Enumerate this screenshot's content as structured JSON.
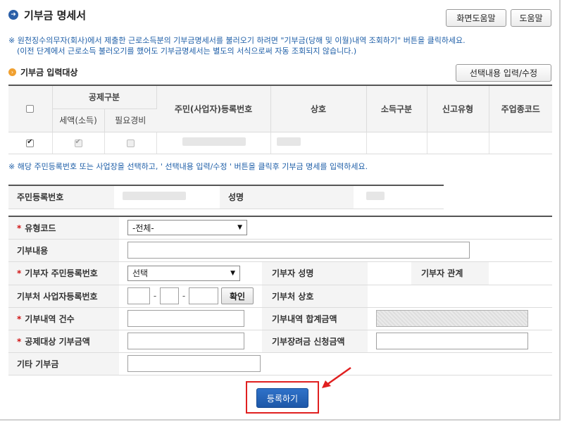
{
  "header": {
    "title": "기부금 명세서",
    "screen_help_label": "화면도움말",
    "help_label": "도움말"
  },
  "notice": {
    "line1": "※ 원천징수의무자(회사)에서 제출한 근로소득분의 기부금명세서를 불러오기 하려면 \"기부금(당해 및 이월)내역 조회하기\" 버튼을 클릭하세요.",
    "line2": "(이전 단계에서 근로소득 불러오기를 했어도 기부금명세서는 별도의 서식으로써 자동 조회되지 않습니다.)"
  },
  "target_section": {
    "title": "기부금 입력대상",
    "edit_button_label": "선택내용 입력/수정",
    "columns": {
      "deduction_group": "공제구분",
      "tax_credit": "세액(소득)",
      "necessary_expense": "필요경비",
      "reg_no": "주민(사업자)등록번호",
      "company": "상호",
      "income_type": "소득구분",
      "report_type": "신고유형",
      "business_code": "주업종코드"
    },
    "row": {
      "selected": true,
      "tax_credit": true,
      "necessary_expense": false
    }
  },
  "guide": "※ 해당 주민등록번호 또는 사업장을 선택하고, ' 선택내용 입력/수정 ' 버튼을 클릭후 기부금 명세를 입력하세요.",
  "id_info": {
    "reg_no_label": "주민등록번호",
    "name_label": "성명"
  },
  "form": {
    "type_code_label": "유형코드",
    "type_code_value": "-전체-",
    "content_label": "기부내용",
    "donor_reg_label": "기부자 주민등록번호",
    "donor_reg_value": "선택",
    "donor_name_label": "기부자 성명",
    "donor_relation_label": "기부자 관계",
    "donee_biz_label": "기부처 사업자등록번호",
    "confirm_label": "확인",
    "donee_name_label": "기부처 상호",
    "count_label": "기부내역 건수",
    "total_label": "기부내역 합계금액",
    "deductible_label": "공제대상 기부금액",
    "incentive_label": "기부장려금 신청금액",
    "other_label": "기타 기부금"
  },
  "register_label": "등록하기",
  "colors": {
    "accent": "#1d57a8",
    "highlight": "#e02020",
    "required": "#d01515"
  }
}
